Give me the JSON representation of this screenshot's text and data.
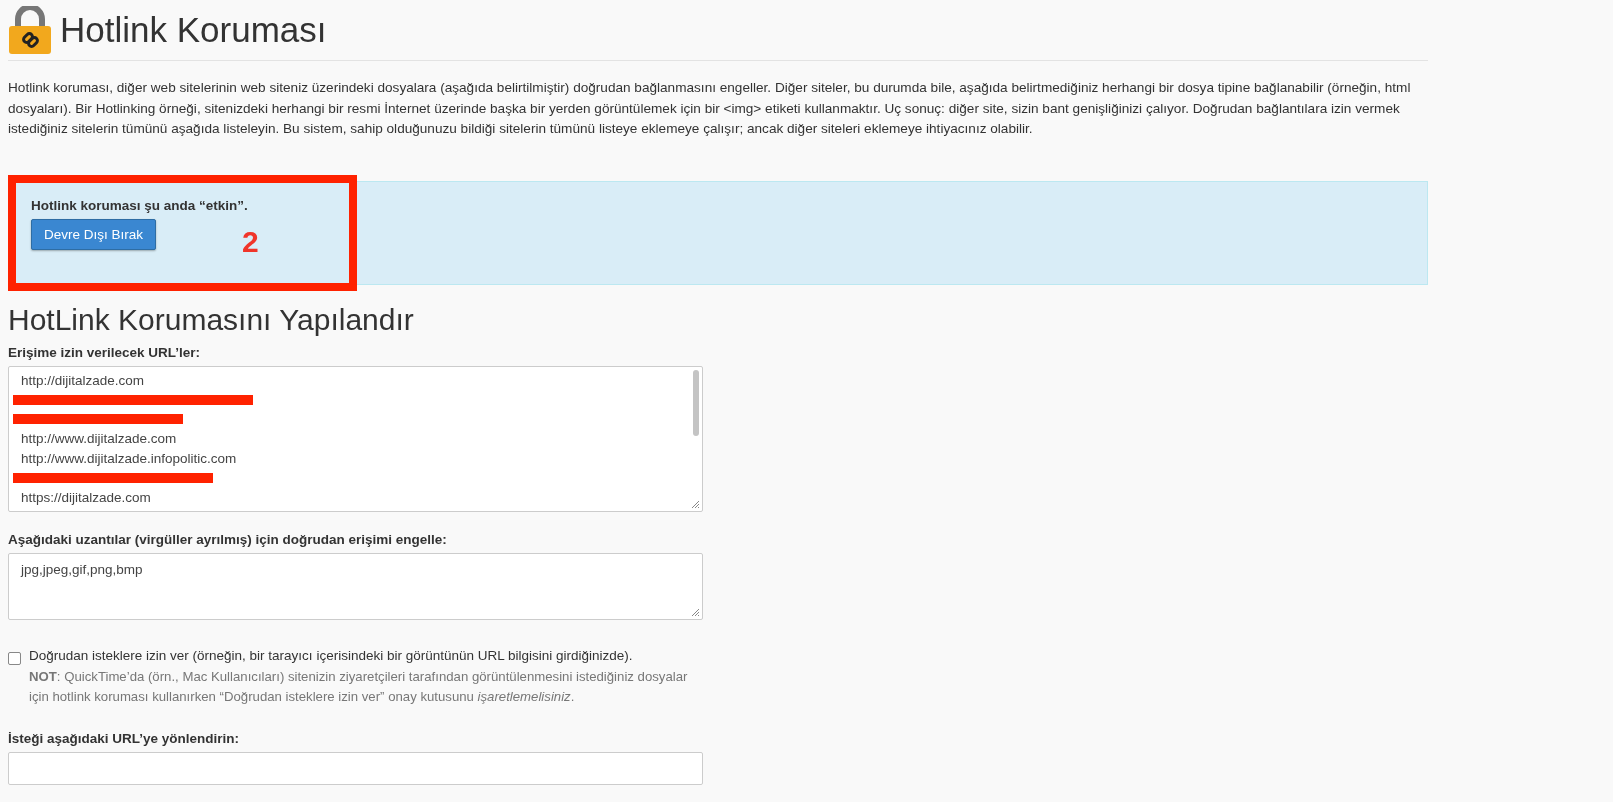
{
  "page": {
    "title": "Hotlink Koruması",
    "description": "Hotlink koruması, diğer web sitelerinin web siteniz üzerindeki dosyalara (aşağıda belirtilmiştir) doğrudan bağlanmasını engeller. Diğer siteler, bu durumda bile, aşağıda belirtmediğiniz herhangi bir dosya tipine bağlanabilir (örneğin, html dosyaları). Bir Hotlinking örneği, sitenizdeki herhangi bir resmi İnternet üzerinde başka bir yerden görüntülemek için bir <img> etiketi kullanmaktır. Uç sonuç: diğer site, sizin bant genişliğinizi çalıyor. Doğrudan bağlantılara izin vermek istediğiniz sitelerin tümünü aşağıda listeleyin. Bu sistem, sahip olduğunuzu bildiği sitelerin tümünü listeye eklemeye çalışır; ancak diğer siteleri eklemeye ihtiyacınız olabilir."
  },
  "status": {
    "message": "Hotlink koruması şu anda “etkin”.",
    "button": "Devre Dışı Bırak"
  },
  "annotation": {
    "label": "2"
  },
  "configure": {
    "heading": "HotLink Korumasını Yapılandır",
    "allowed_urls": {
      "label": "Erişime izin verilecek URL’ler:",
      "lines": [
        {
          "kind": "text",
          "text": "http://dijitalzade.com"
        },
        {
          "kind": "redacted"
        },
        {
          "kind": "redacted"
        },
        {
          "kind": "text",
          "text": "http://www.dijitalzade.com"
        },
        {
          "kind": "text",
          "text": "http://www.dijitalzade.infopolitic.com"
        },
        {
          "kind": "redacted"
        },
        {
          "kind": "text",
          "text": "https://dijitalzade.com"
        }
      ]
    },
    "extensions": {
      "label": "Aşağıdaki uzantılar (virgüller ayrılmış) için doğrudan erişimi engelle:",
      "value": "jpg,jpeg,gif,png,bmp"
    },
    "direct_requests": {
      "checked": false,
      "label": "Doğrudan isteklere izin ver (örneğin, bir tarayıcı içerisindeki bir görüntünün URL bilgisini girdiğinizde).",
      "note": "**NOT**: QuickTime’da (örn., Mac Kullanıcıları) sitenizin ziyaretçileri tarafından görüntülenmesini istediğiniz dosyalar için hotlink koruması kullanırken “Doğrudan isteklere izin ver” onay kutusunu *işaretlemelisiniz*."
    },
    "redirect": {
      "label": "İsteği aşağıdaki URL’ye yönlendirin:"
    }
  }
}
